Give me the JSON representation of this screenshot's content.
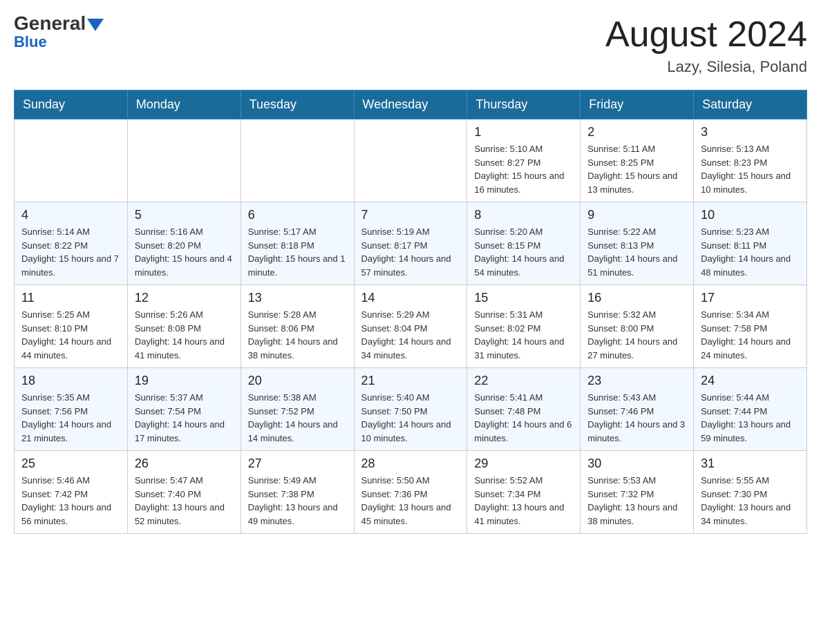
{
  "header": {
    "logo_general": "General",
    "logo_blue": "Blue",
    "month_title": "August 2024",
    "location": "Lazy, Silesia, Poland"
  },
  "days_of_week": [
    "Sunday",
    "Monday",
    "Tuesday",
    "Wednesday",
    "Thursday",
    "Friday",
    "Saturday"
  ],
  "weeks": [
    {
      "days": [
        {
          "number": "",
          "info": ""
        },
        {
          "number": "",
          "info": ""
        },
        {
          "number": "",
          "info": ""
        },
        {
          "number": "",
          "info": ""
        },
        {
          "number": "1",
          "info": "Sunrise: 5:10 AM\nSunset: 8:27 PM\nDaylight: 15 hours and 16 minutes."
        },
        {
          "number": "2",
          "info": "Sunrise: 5:11 AM\nSunset: 8:25 PM\nDaylight: 15 hours and 13 minutes."
        },
        {
          "number": "3",
          "info": "Sunrise: 5:13 AM\nSunset: 8:23 PM\nDaylight: 15 hours and 10 minutes."
        }
      ]
    },
    {
      "days": [
        {
          "number": "4",
          "info": "Sunrise: 5:14 AM\nSunset: 8:22 PM\nDaylight: 15 hours and 7 minutes."
        },
        {
          "number": "5",
          "info": "Sunrise: 5:16 AM\nSunset: 8:20 PM\nDaylight: 15 hours and 4 minutes."
        },
        {
          "number": "6",
          "info": "Sunrise: 5:17 AM\nSunset: 8:18 PM\nDaylight: 15 hours and 1 minute."
        },
        {
          "number": "7",
          "info": "Sunrise: 5:19 AM\nSunset: 8:17 PM\nDaylight: 14 hours and 57 minutes."
        },
        {
          "number": "8",
          "info": "Sunrise: 5:20 AM\nSunset: 8:15 PM\nDaylight: 14 hours and 54 minutes."
        },
        {
          "number": "9",
          "info": "Sunrise: 5:22 AM\nSunset: 8:13 PM\nDaylight: 14 hours and 51 minutes."
        },
        {
          "number": "10",
          "info": "Sunrise: 5:23 AM\nSunset: 8:11 PM\nDaylight: 14 hours and 48 minutes."
        }
      ]
    },
    {
      "days": [
        {
          "number": "11",
          "info": "Sunrise: 5:25 AM\nSunset: 8:10 PM\nDaylight: 14 hours and 44 minutes."
        },
        {
          "number": "12",
          "info": "Sunrise: 5:26 AM\nSunset: 8:08 PM\nDaylight: 14 hours and 41 minutes."
        },
        {
          "number": "13",
          "info": "Sunrise: 5:28 AM\nSunset: 8:06 PM\nDaylight: 14 hours and 38 minutes."
        },
        {
          "number": "14",
          "info": "Sunrise: 5:29 AM\nSunset: 8:04 PM\nDaylight: 14 hours and 34 minutes."
        },
        {
          "number": "15",
          "info": "Sunrise: 5:31 AM\nSunset: 8:02 PM\nDaylight: 14 hours and 31 minutes."
        },
        {
          "number": "16",
          "info": "Sunrise: 5:32 AM\nSunset: 8:00 PM\nDaylight: 14 hours and 27 minutes."
        },
        {
          "number": "17",
          "info": "Sunrise: 5:34 AM\nSunset: 7:58 PM\nDaylight: 14 hours and 24 minutes."
        }
      ]
    },
    {
      "days": [
        {
          "number": "18",
          "info": "Sunrise: 5:35 AM\nSunset: 7:56 PM\nDaylight: 14 hours and 21 minutes."
        },
        {
          "number": "19",
          "info": "Sunrise: 5:37 AM\nSunset: 7:54 PM\nDaylight: 14 hours and 17 minutes."
        },
        {
          "number": "20",
          "info": "Sunrise: 5:38 AM\nSunset: 7:52 PM\nDaylight: 14 hours and 14 minutes."
        },
        {
          "number": "21",
          "info": "Sunrise: 5:40 AM\nSunset: 7:50 PM\nDaylight: 14 hours and 10 minutes."
        },
        {
          "number": "22",
          "info": "Sunrise: 5:41 AM\nSunset: 7:48 PM\nDaylight: 14 hours and 6 minutes."
        },
        {
          "number": "23",
          "info": "Sunrise: 5:43 AM\nSunset: 7:46 PM\nDaylight: 14 hours and 3 minutes."
        },
        {
          "number": "24",
          "info": "Sunrise: 5:44 AM\nSunset: 7:44 PM\nDaylight: 13 hours and 59 minutes."
        }
      ]
    },
    {
      "days": [
        {
          "number": "25",
          "info": "Sunrise: 5:46 AM\nSunset: 7:42 PM\nDaylight: 13 hours and 56 minutes."
        },
        {
          "number": "26",
          "info": "Sunrise: 5:47 AM\nSunset: 7:40 PM\nDaylight: 13 hours and 52 minutes."
        },
        {
          "number": "27",
          "info": "Sunrise: 5:49 AM\nSunset: 7:38 PM\nDaylight: 13 hours and 49 minutes."
        },
        {
          "number": "28",
          "info": "Sunrise: 5:50 AM\nSunset: 7:36 PM\nDaylight: 13 hours and 45 minutes."
        },
        {
          "number": "29",
          "info": "Sunrise: 5:52 AM\nSunset: 7:34 PM\nDaylight: 13 hours and 41 minutes."
        },
        {
          "number": "30",
          "info": "Sunrise: 5:53 AM\nSunset: 7:32 PM\nDaylight: 13 hours and 38 minutes."
        },
        {
          "number": "31",
          "info": "Sunrise: 5:55 AM\nSunset: 7:30 PM\nDaylight: 13 hours and 34 minutes."
        }
      ]
    }
  ]
}
